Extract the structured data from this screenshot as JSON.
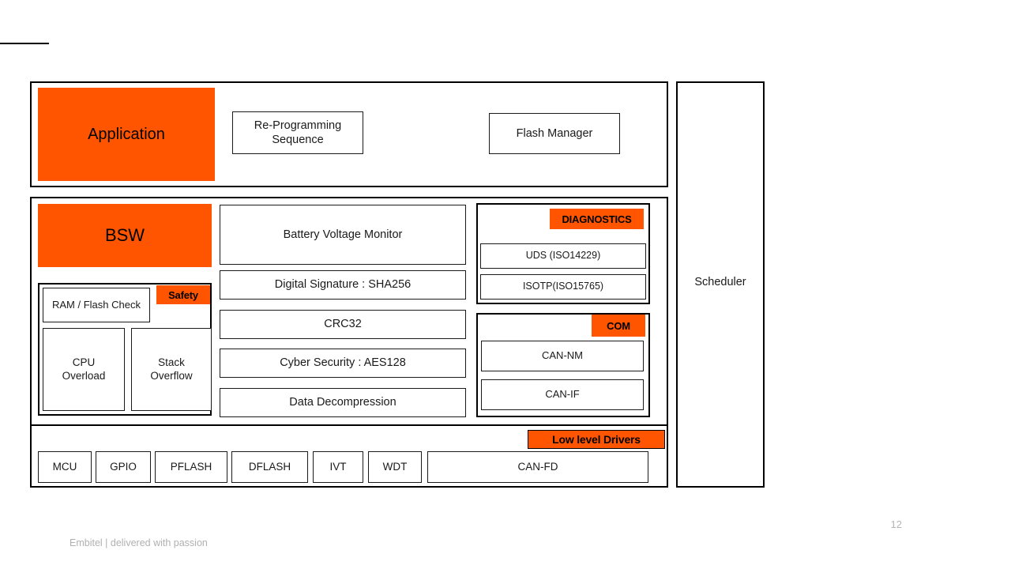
{
  "slide": {
    "page_number": "12",
    "footer_text": "Embitel | delivered with passion",
    "accent_color": "#FF5500",
    "line_color": "#000000"
  },
  "application_layer": {
    "title": "Application",
    "items": [
      {
        "label": "Re-Programming\nSequence"
      },
      {
        "label": "Flash Manager"
      }
    ]
  },
  "bsw_layer": {
    "title": "BSW",
    "safety_group": {
      "badge": "Safety",
      "items": [
        {
          "label": "RAM / Flash  Check"
        },
        {
          "label": "CPU\nOverload"
        },
        {
          "label": "Stack\nOverflow"
        }
      ]
    },
    "services": [
      {
        "label": "Battery Voltage Monitor"
      },
      {
        "label": "Digital Signature : SHA256"
      },
      {
        "label": "CRC32"
      },
      {
        "label": "Cyber Security : AES128"
      },
      {
        "label": "Data Decompression"
      }
    ],
    "diagnostics_group": {
      "badge": "DIAGNOSTICS",
      "items": [
        {
          "label": "UDS (ISO14229)"
        },
        {
          "label": "ISOTP(ISO15765)"
        }
      ]
    },
    "com_group": {
      "badge": "COM",
      "items": [
        {
          "label": "CAN-NM"
        },
        {
          "label": "CAN-IF"
        }
      ]
    }
  },
  "low_level_drivers": {
    "badge": "Low level Drivers",
    "items": [
      {
        "label": "MCU"
      },
      {
        "label": "GPIO"
      },
      {
        "label": "PFLASH"
      },
      {
        "label": "DFLASH"
      },
      {
        "label": "IVT"
      },
      {
        "label": "WDT"
      },
      {
        "label": "CAN-FD"
      }
    ]
  },
  "scheduler": {
    "label": "Scheduler"
  }
}
